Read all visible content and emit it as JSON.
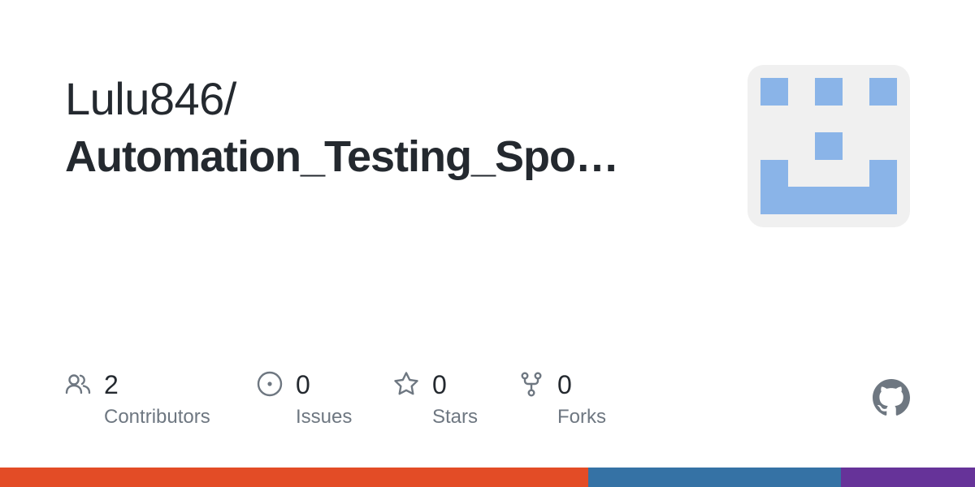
{
  "repo": {
    "owner": "Lulu846/",
    "name": "Automation_Testing_Spo…"
  },
  "avatar": {
    "icon": "identicon",
    "color": "#8ab4e8",
    "background": "#f0f0f0"
  },
  "stats": [
    {
      "key": "contributors",
      "icon": "people-icon",
      "value": "2",
      "label": "Contributors"
    },
    {
      "key": "issues",
      "icon": "issue-opened-icon",
      "value": "0",
      "label": "Issues"
    },
    {
      "key": "stars",
      "icon": "star-icon",
      "value": "0",
      "label": "Stars"
    },
    {
      "key": "forks",
      "icon": "repo-forked-icon",
      "value": "0",
      "label": "Forks"
    }
  ],
  "brand": {
    "icon": "github-mark-icon",
    "icon_color": "#6e7781"
  },
  "language_bar": [
    {
      "color": "#e34c26",
      "share": 0.603
    },
    {
      "color": "#3572a5",
      "share": 0.259
    },
    {
      "color": "#663399",
      "share": 0.138
    }
  ]
}
